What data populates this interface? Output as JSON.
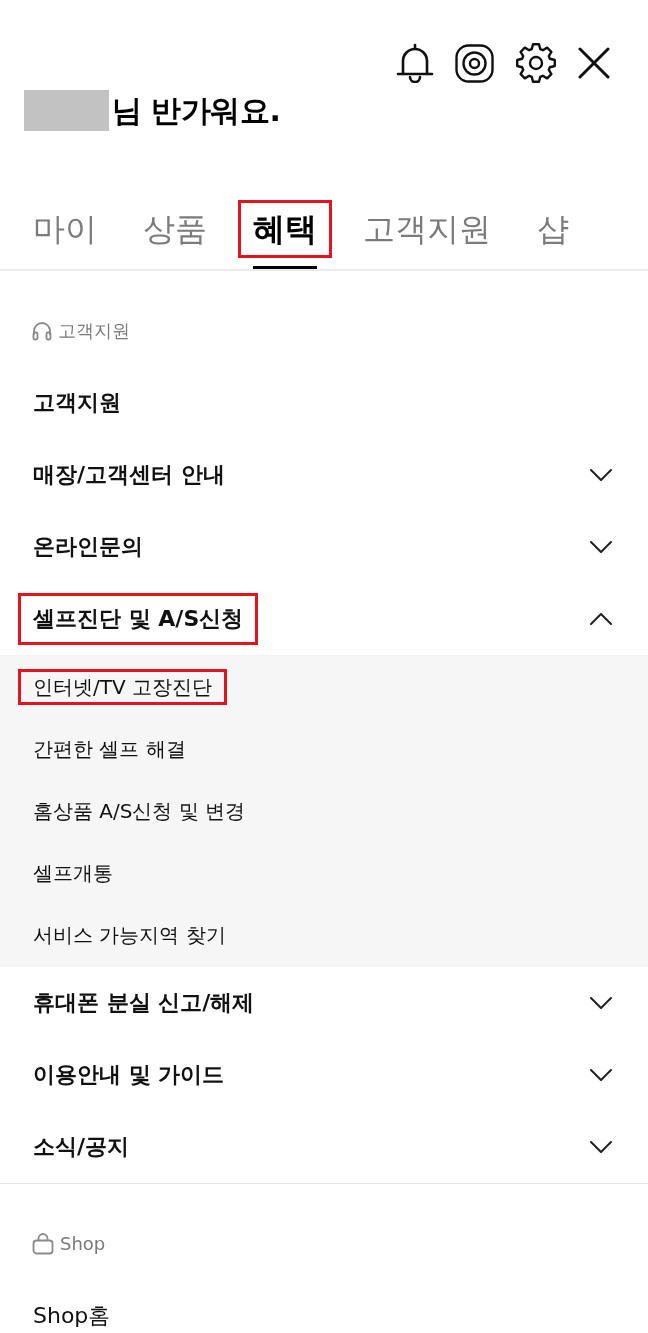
{
  "greeting": {
    "text": "님 반가워요."
  },
  "tabs": [
    {
      "label": "마이",
      "selected": false,
      "highlighted": false
    },
    {
      "label": "상품",
      "selected": false,
      "highlighted": false
    },
    {
      "label": "혜택",
      "selected": true,
      "highlighted": true
    },
    {
      "label": "고객지원",
      "selected": false,
      "highlighted": false
    },
    {
      "label": "샵",
      "selected": false,
      "highlighted": false
    }
  ],
  "sections": [
    {
      "title": "고객지원",
      "items": [
        {
          "kind": "link",
          "label": "고객지원",
          "highlighted": false
        },
        {
          "kind": "accordion",
          "label": "매장/고객센터 안내",
          "expanded": false,
          "highlighted": false
        },
        {
          "kind": "accordion",
          "label": "온라인문의",
          "expanded": false,
          "highlighted": false
        },
        {
          "kind": "accordion",
          "label": "셀프진단 및 A/S신청",
          "expanded": true,
          "highlighted": true,
          "children": [
            {
              "label": "인터넷/TV 고장진단",
              "highlighted": true
            },
            {
              "label": "간편한 셀프 해결",
              "highlighted": false
            },
            {
              "label": "홈상품 A/S신청 및 변경",
              "highlighted": false
            },
            {
              "label": "셀프개통",
              "highlighted": false
            },
            {
              "label": "서비스 가능지역 찾기",
              "highlighted": false
            }
          ]
        },
        {
          "kind": "accordion",
          "label": "휴대폰 분실 신고/해제",
          "expanded": false,
          "highlighted": false
        },
        {
          "kind": "accordion",
          "label": "이용안내 및 가이드",
          "expanded": false,
          "highlighted": false
        },
        {
          "kind": "accordion",
          "label": "소식/공지",
          "expanded": false,
          "highlighted": false
        }
      ]
    },
    {
      "title": "Shop",
      "items": [
        {
          "kind": "page",
          "label": "Shop홈",
          "highlighted": false
        }
      ]
    }
  ]
}
